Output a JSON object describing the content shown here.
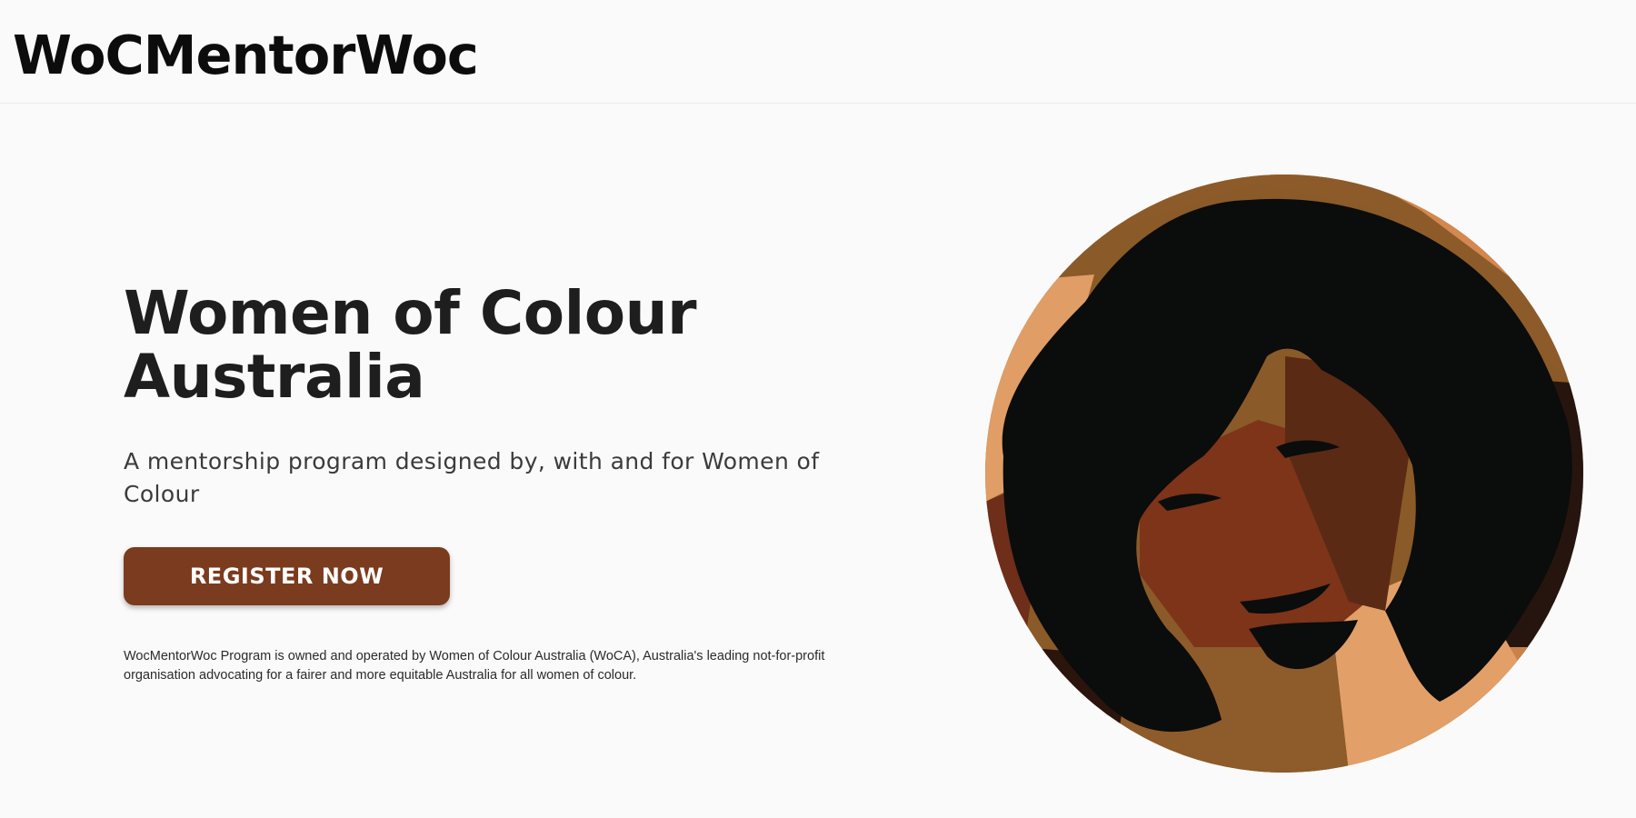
{
  "header": {
    "brand": "WoCMentorWoc"
  },
  "hero": {
    "title": "Women of Colour Australia",
    "subtitle": "A mentorship program designed by, with and for Women of Colour",
    "cta_label": "REGISTER NOW",
    "disclaimer": "WocMentorWoc Program is owned and operated by Women of Colour Australia (WoCA), Australia's leading not-for-profit organisation advocating for a fairer and more equitable Australia for all women of colour."
  },
  "colors": {
    "background": "#fafafa",
    "accent": "#7b3b1e",
    "title": "#1e1e1e"
  },
  "illustration": {
    "icon": "woman-portrait-illustration"
  }
}
